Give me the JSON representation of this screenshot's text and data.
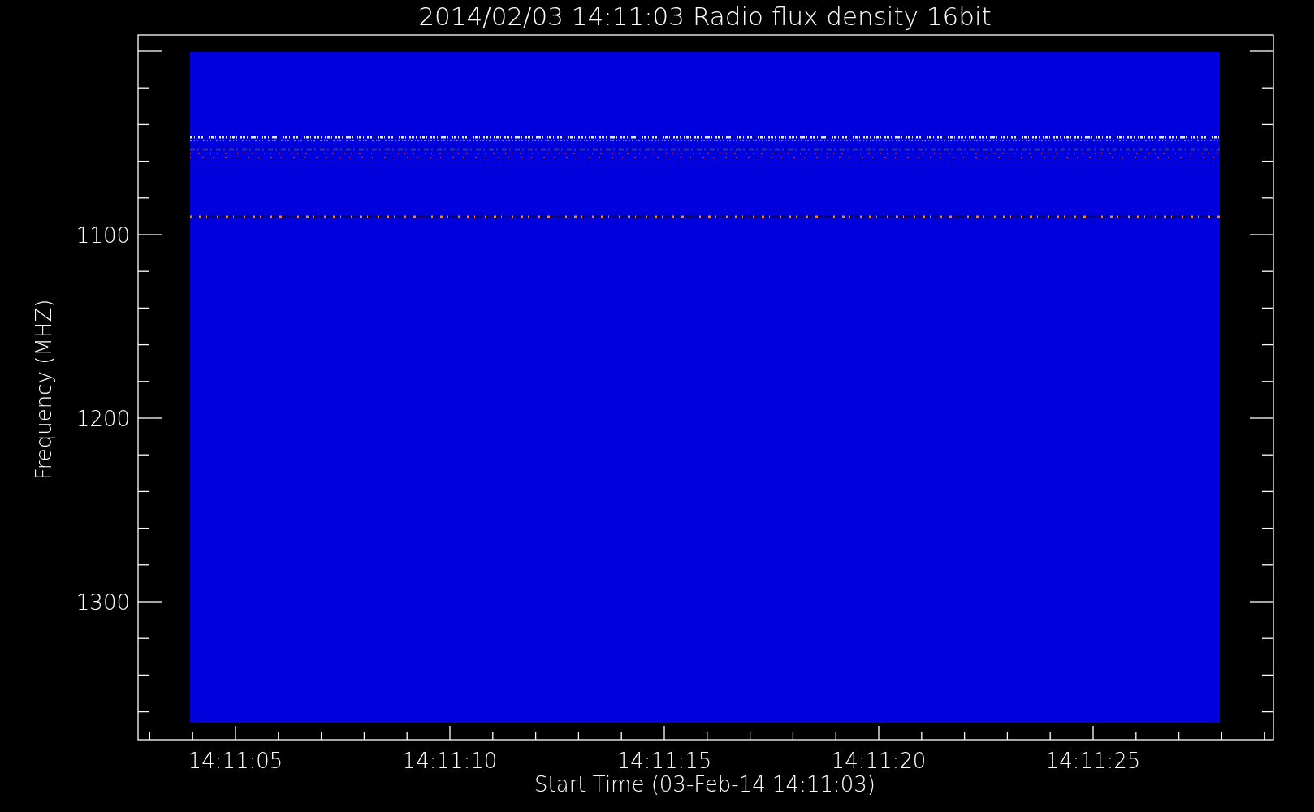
{
  "title": "2014/02/03 14:11:03 Radio flux density 16bit",
  "plot": {
    "ylabel": "Frequency (MHZ)",
    "yticks": [
      "1100",
      "1200",
      "1300"
    ],
    "xticks": [
      "14:11:05",
      "14:11:10",
      "14:11:15",
      "14:11:20",
      "14:11:25"
    ],
    "xlabel": "Start Time (03-Feb-14 14:11:03)"
  }
}
